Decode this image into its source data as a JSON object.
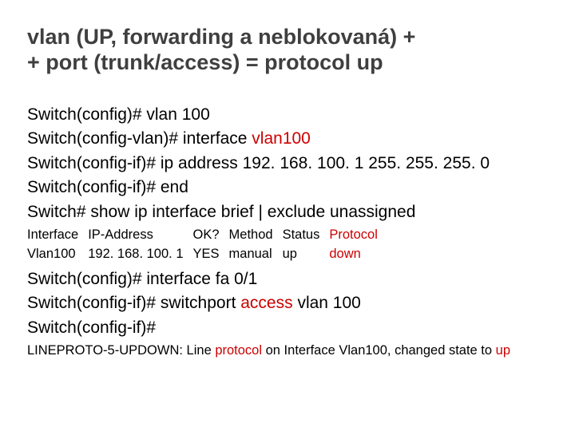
{
  "title": {
    "line1": "vlan (UP, forwarding a neblokovaná) +",
    "line2": "+ port (trunk/access) = protocol up"
  },
  "cli1": {
    "l1": "Switch(config)# vlan 100",
    "l2a": "Switch(config-vlan)# interface ",
    "l2b": "vlan100",
    "l3": "Switch(config-if)# ip address 192. 168. 100. 1 255. 255. 255. 0",
    "l4": "Switch(config-if)# end",
    "l5": "Switch# show ip interface brief | exclude unassigned"
  },
  "table": {
    "h1": "Interface",
    "h2": "IP-Address",
    "h3": "OK?",
    "h4": "Method",
    "h5": "Status",
    "h6": "Protocol",
    "r1": "Vlan100",
    "r2": "192. 168. 100. 1",
    "r3": "YES",
    "r4": "manual",
    "r5": "up",
    "r6": "down"
  },
  "cli2": {
    "l1": "Switch(config)# interface fa 0/1",
    "l2a": "Switch(config-if)# switchport ",
    "l2b": "access",
    "l2c": " vlan 100",
    "l3": "Switch(config-if)#"
  },
  "syslog": {
    "a": "LINEPROTO-5-UPDOWN: Line ",
    "b": "protocol",
    "c": " on Interface Vlan100, changed state to ",
    "d": "up"
  }
}
